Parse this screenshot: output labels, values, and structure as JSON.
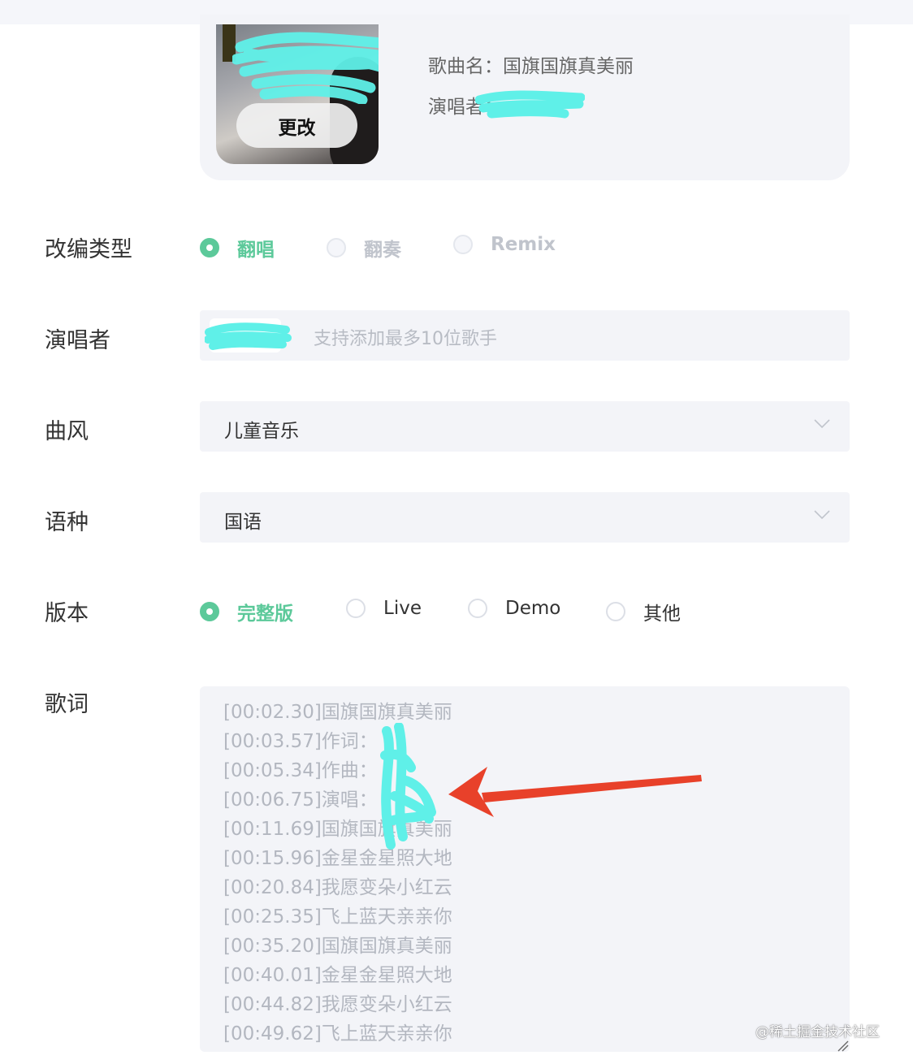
{
  "song_card": {
    "change_button": "更改",
    "song_name_line": "歌曲名：国旗国旗真美丽",
    "singer_line_prefix": "演唱者："
  },
  "form": {
    "adaptation_type": {
      "label": "改编类型",
      "options": [
        "翻唱",
        "翻奏",
        "Remix"
      ],
      "selected": "翻唱"
    },
    "singer": {
      "label": "演唱者",
      "placeholder": "支持添加最多10位歌手"
    },
    "genre": {
      "label": "曲风",
      "value": "儿童音乐"
    },
    "language": {
      "label": "语种",
      "value": "国语"
    },
    "version": {
      "label": "版本",
      "options": [
        "完整版",
        "Live",
        "Demo",
        "其他"
      ],
      "selected": "完整版"
    },
    "lyrics": {
      "label": "歌词",
      "lines": [
        "[00:02.30]国旗国旗真美丽",
        "[00:03.57]作词：",
        "[00:05.34]作曲：",
        "[00:06.75]演唱：",
        "[00:11.69]国旗国旗真美丽",
        "[00:15.96]金星金星照大地",
        "[00:20.84]我愿变朵小红云",
        "[00:25.35]飞上蓝天亲亲你",
        "[00:35.20]国旗国旗真美丽",
        "[00:40.01]金星金星照大地",
        "[00:44.82]我愿变朵小红云",
        "[00:49.62]飞上蓝天亲亲你"
      ]
    }
  },
  "watermark": "@稀土掘金技术社区",
  "colors": {
    "accent": "#5cc99a",
    "field_bg": "#f3f4f8",
    "arrow": "#e8412a",
    "redaction": "#5ff0e8"
  }
}
